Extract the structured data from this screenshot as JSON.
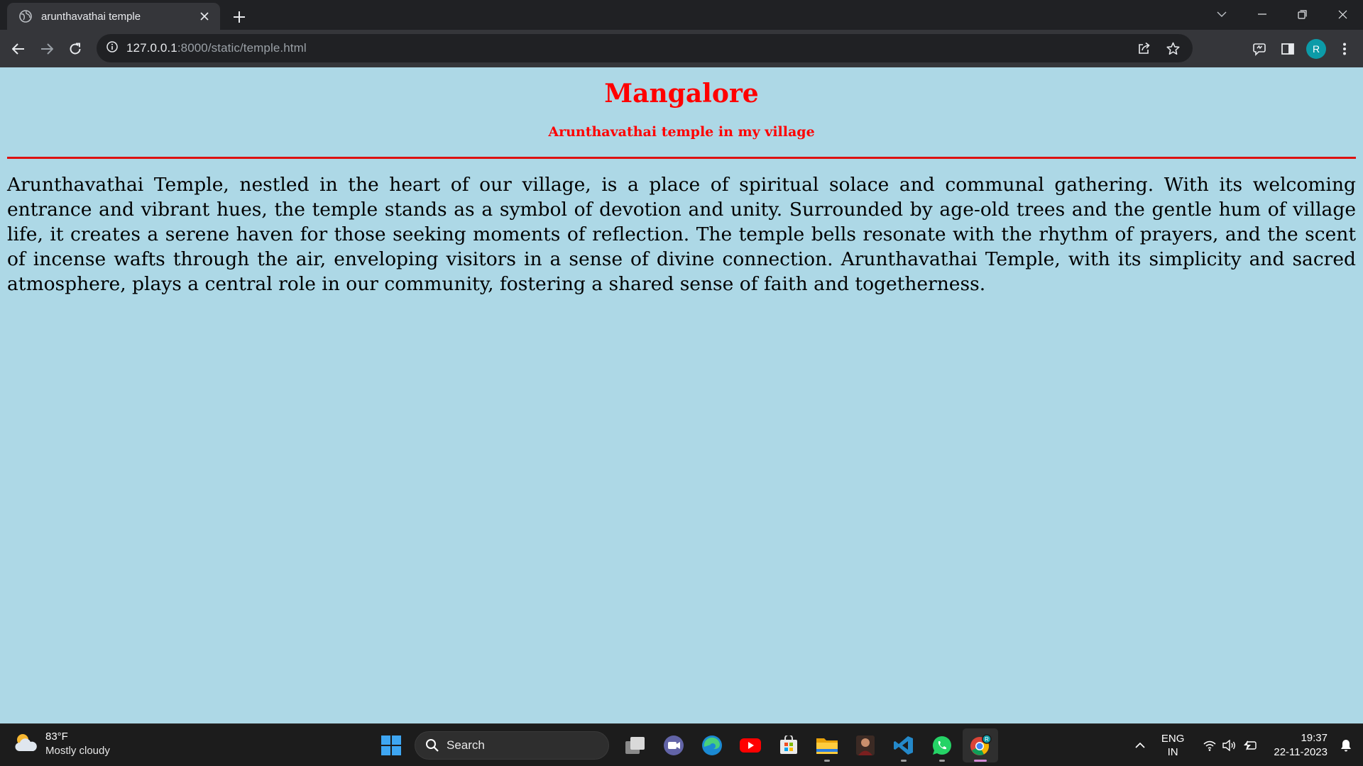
{
  "browser": {
    "tab": {
      "title": "arunthavathai temple"
    },
    "address": {
      "host": "127.0.0.1",
      "path": ":8000/static/temple.html"
    },
    "profile_initial": "R"
  },
  "page": {
    "heading": "Mangalore",
    "subheading": "Arunthavathai temple in my village",
    "paragraph": "Arunthavathai Temple, nestled in the heart of our village, is a place of spiritual solace and communal gathering. With its welcoming entrance and vibrant hues, the temple stands as a symbol of devotion and unity. Surrounded by age-old trees and the gentle hum of village life, it creates a serene haven for those seeking moments of reflection. The temple bells resonate with the rhythm of prayers, and the scent of incense wafts through the air, enveloping visitors in a sense of divine connection. Arunthavathai Temple, with its simplicity and sacred atmosphere, plays a central role in our community, fostering a shared sense of faith and togetherness.",
    "colors": {
      "background": "#add8e6",
      "heading": "#ff0000",
      "rule": "#dd1111"
    }
  },
  "taskbar": {
    "weather": {
      "temp": "83°F",
      "condition": "Mostly cloudy"
    },
    "search_label": "Search",
    "apps": [
      "task-view",
      "teams-meet",
      "edge",
      "youtube",
      "microsoft-store",
      "file-explorer",
      "photo-app",
      "vscode",
      "whatsapp",
      "chrome"
    ],
    "language": {
      "line1": "ENG",
      "line2": "IN"
    },
    "clock": {
      "time": "19:37",
      "date": "22-11-2023"
    }
  }
}
